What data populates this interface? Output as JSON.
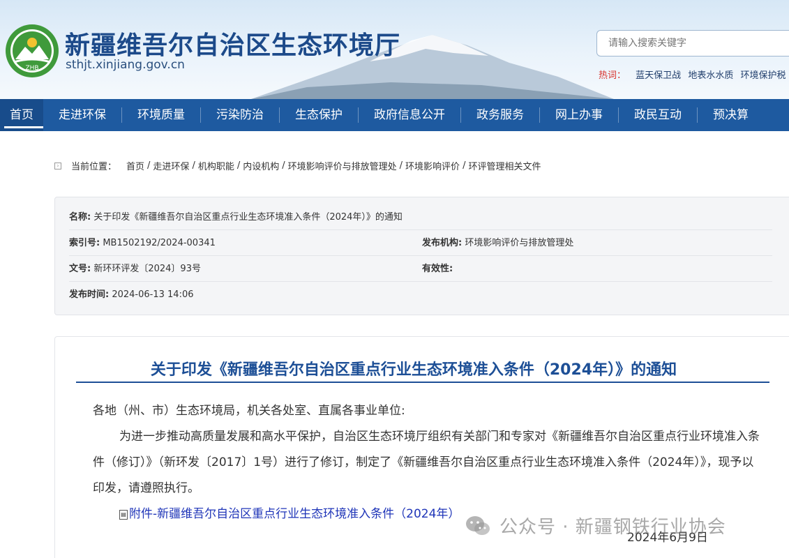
{
  "header": {
    "logo_text": "ZHB",
    "site_title": "新疆维吾尔自治区生态环境厅",
    "domain": "sthjt.xinjiang.gov.cn",
    "search_placeholder": "请输入搜索关键字",
    "hotwords_label": "热词：",
    "hotwords": [
      "蓝天保卫战",
      "地表水水质",
      "环境保护税"
    ]
  },
  "nav": {
    "items": [
      "首页",
      "走进环保",
      "环境质量",
      "污染防治",
      "生态保护",
      "政府信息公开",
      "政务服务",
      "网上办事",
      "政民互动",
      "预决算"
    ]
  },
  "breadcrumb": {
    "label": "当前位置：",
    "items": [
      "首页",
      "走进环保",
      "机构职能",
      "内设机构",
      "环境影响评价与排放管理处",
      "环境影响评价",
      "环评管理相关文件"
    ]
  },
  "info": {
    "name_label": "名称:",
    "name_value": "关于印发《新疆维吾尔自治区重点行业生态环境准入条件（2024年）》的通知",
    "index_label": "索引号:",
    "index_value": "MB1502192/2024-00341",
    "publisher_label": "发布机构:",
    "publisher_value": "环境影响评价与排放管理处",
    "docno_label": "文号:",
    "docno_value": "新环环评发〔2024〕93号",
    "validity_label": "有效性:",
    "validity_value": "",
    "time_label": "发布时间:",
    "time_value": "2024-06-13 14:06"
  },
  "article": {
    "title": "关于印发《新疆维吾尔自治区重点行业生态环境准入条件（2024年）》的通知",
    "salutation": "各地（州、市）生态环境局，机关各处室、直属各事业单位:",
    "paragraph": "为进一步推动高质量发展和高水平保护，自治区生态环境厅组织有关部门和专家对《新疆维吾尔自治区重点行业环境准入条件（修订）》（新环发〔2017〕1号）进行了修订，制定了《新疆维吾尔自治区重点行业生态环境准入条件（2024年）》，现予以印发，请遵照执行。",
    "attachment": "附件-新疆维吾尔自治区重点行业生态环境准入条件（2024年）",
    "date": "2024年6月9日"
  },
  "watermark": {
    "text": "公众号 · 新疆钢铁行业协会"
  },
  "colors": {
    "nav_bg": "#1e5aa0",
    "title_blue": "#1d4f96",
    "link_blue": "#1f35b8",
    "hot_red": "#d8322c"
  }
}
